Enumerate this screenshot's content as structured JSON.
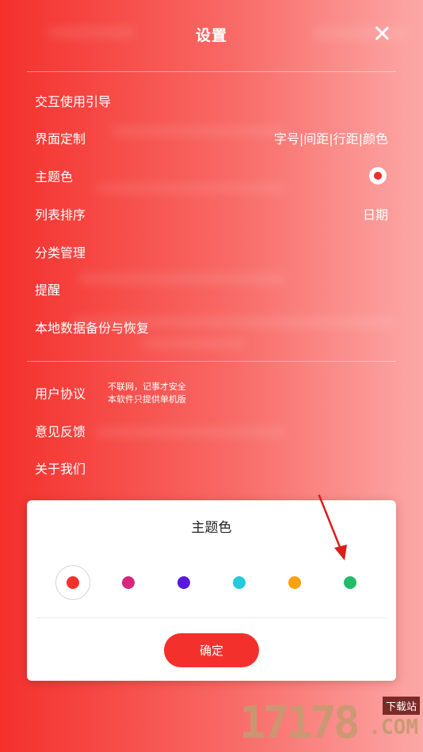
{
  "header": {
    "title": "设置",
    "close_icon": "close-icon"
  },
  "settings": [
    {
      "label": "交互使用引导",
      "value": ""
    },
    {
      "label": "界面定制",
      "value": "字号|间距|行距|颜色"
    },
    {
      "label": "主题色",
      "value": ""
    },
    {
      "label": "列表排序",
      "value": "日期"
    },
    {
      "label": "分类管理",
      "value": ""
    },
    {
      "label": "提醒",
      "value": ""
    },
    {
      "label": "本地数据备份与恢复",
      "value": ""
    }
  ],
  "settings2": [
    {
      "label": "用户协议"
    },
    {
      "label": "意见反馈"
    },
    {
      "label": "关于我们"
    }
  ],
  "note": {
    "line1": "不联网，记事才安全",
    "line2": "本软件只提供单机版"
  },
  "dialog": {
    "title": "主题色",
    "confirm": "确定",
    "colors": [
      "#f4302c",
      "#d6267e",
      "#5a18dc",
      "#25c8dc",
      "#f9a10e",
      "#22bb6a"
    ],
    "selected_index": 0
  },
  "watermark": {
    "number": "17178",
    "tag": "下载站",
    "domain": ".COM"
  }
}
